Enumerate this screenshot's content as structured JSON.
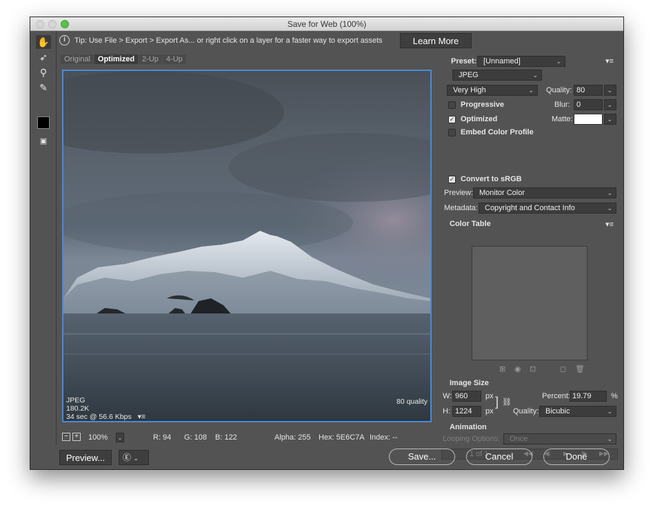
{
  "window": {
    "title": "Save for Web (100%)"
  },
  "tip": {
    "text": "Tip: Use File > Export > Export As...  or right click on a layer for a faster way to export assets",
    "learn_more": "Learn More"
  },
  "tabs": [
    "Original",
    "Optimized",
    "2-Up",
    "4-Up"
  ],
  "preview": {
    "format": "JPEG",
    "size": "180.2K",
    "time": "34 sec @ 56.6 Kbps",
    "quality_text": "80 quality"
  },
  "status": {
    "zoom": "100%",
    "r": "R: 94",
    "g": "G: 108",
    "b": "B: 122",
    "alpha": "Alpha: 255",
    "hex": "Hex: 5E6C7A",
    "index": "Index: --"
  },
  "settings": {
    "preset_label": "Preset:",
    "preset_value": "[Unnamed]",
    "format_value": "JPEG",
    "quality_preset": "Very High",
    "quality_label": "Quality:",
    "quality_value": "80",
    "progressive_label": "Progressive",
    "blur_label": "Blur:",
    "blur_value": "0",
    "optimized_label": "Optimized",
    "matte_label": "Matte:",
    "embed_label": "Embed Color Profile",
    "srgb_label": "Convert to sRGB",
    "preview_label": "Preview:",
    "preview_value": "Monitor Color",
    "metadata_label": "Metadata:",
    "metadata_value": "Copyright and Contact Info",
    "color_table_label": "Color Table",
    "image_size_label": "Image Size",
    "w_label": "W:",
    "w_value": "960",
    "h_label": "H:",
    "h_value": "1224",
    "px": "px",
    "percent_label": "Percent:",
    "percent_value": "19.79",
    "percent_unit": "%",
    "resample_label": "Quality:",
    "resample_value": "Bicubic",
    "animation_label": "Animation",
    "looping_label": "Looping Options:",
    "looping_value": "Once",
    "frame_counter": "1 of 1"
  },
  "buttons": {
    "preview": "Preview...",
    "save": "Save...",
    "cancel": "Cancel",
    "done": "Done"
  }
}
